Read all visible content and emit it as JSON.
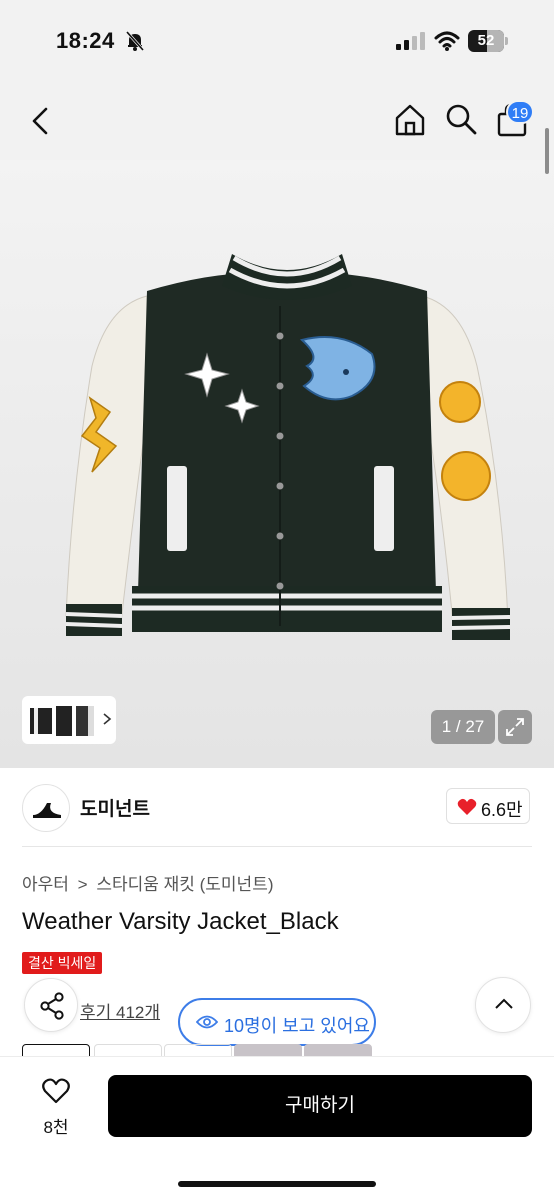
{
  "status_bar": {
    "time": "18:24",
    "battery": "52"
  },
  "nav": {
    "cart_count": "19"
  },
  "gallery": {
    "counter": "1 / 27"
  },
  "brand": {
    "name": "도미넌트",
    "likes": "6.6만"
  },
  "breadcrumb": {
    "category": "아우터",
    "separator": ">",
    "subcategory": "스타디움 재킷 (도미넌트)"
  },
  "product": {
    "title": "Weather Varsity Jacket_Black",
    "sale_badge": "결산 빅세일"
  },
  "reviews": {
    "link": "후기 412개"
  },
  "viewers": {
    "text": "10명이 보고 있어요"
  },
  "bottom_bar": {
    "wish_count": "8천",
    "buy_label": "구매하기"
  },
  "colors": {
    "accent_blue": "#3d7de8",
    "sale_red": "#e11b1b",
    "heart_red": "#e8202a",
    "buy_black": "#000000"
  }
}
